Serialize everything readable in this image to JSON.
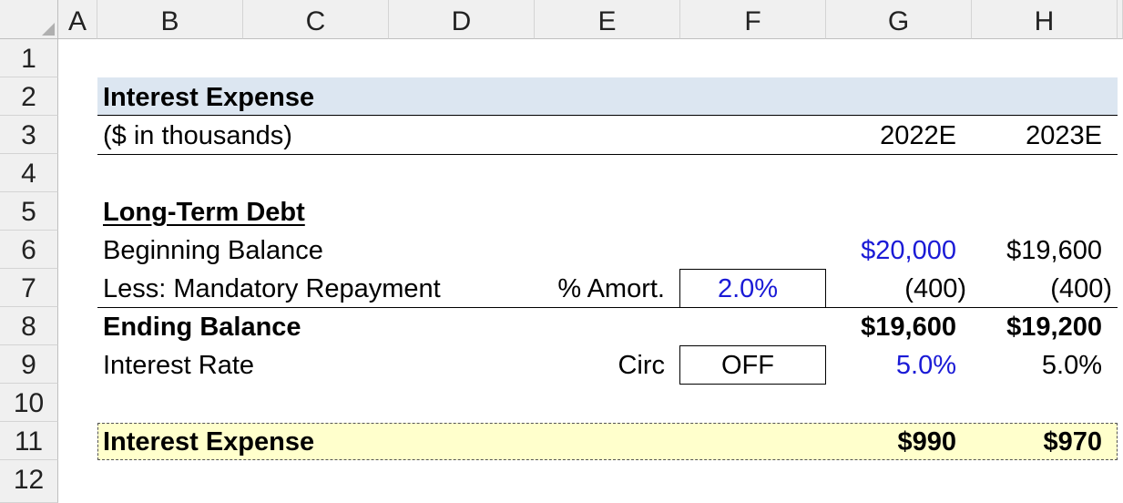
{
  "columns": [
    "A",
    "B",
    "C",
    "D",
    "E",
    "F",
    "G",
    "H"
  ],
  "rows": [
    "1",
    "2",
    "3",
    "4",
    "5",
    "6",
    "7",
    "8",
    "9",
    "10",
    "11",
    "12"
  ],
  "title": "Interest Expense",
  "units": "($ in thousands)",
  "years": [
    "2022E",
    "2023E"
  ],
  "section_header": "Long-Term Debt",
  "beginning_balance": {
    "label": "Beginning Balance",
    "values": [
      "$20,000",
      "$19,600"
    ]
  },
  "repayment": {
    "label": "Less: Mandatory Repayment",
    "input_label": "% Amort.",
    "input_value": "2.0%",
    "values": [
      "(400)",
      "(400)"
    ]
  },
  "ending_balance": {
    "label": "Ending Balance",
    "values": [
      "$19,600",
      "$19,200"
    ]
  },
  "interest_rate": {
    "label": "Interest Rate",
    "toggle_label": "Circ",
    "toggle_value": "OFF",
    "values": [
      "5.0%",
      "5.0%"
    ]
  },
  "interest_expense": {
    "label": "Interest Expense",
    "values": [
      "$990",
      "$970"
    ]
  },
  "colors": {
    "header_band": "#dce6f1",
    "total_band": "#ffffcc",
    "input_blue": "#1a1ad6"
  }
}
